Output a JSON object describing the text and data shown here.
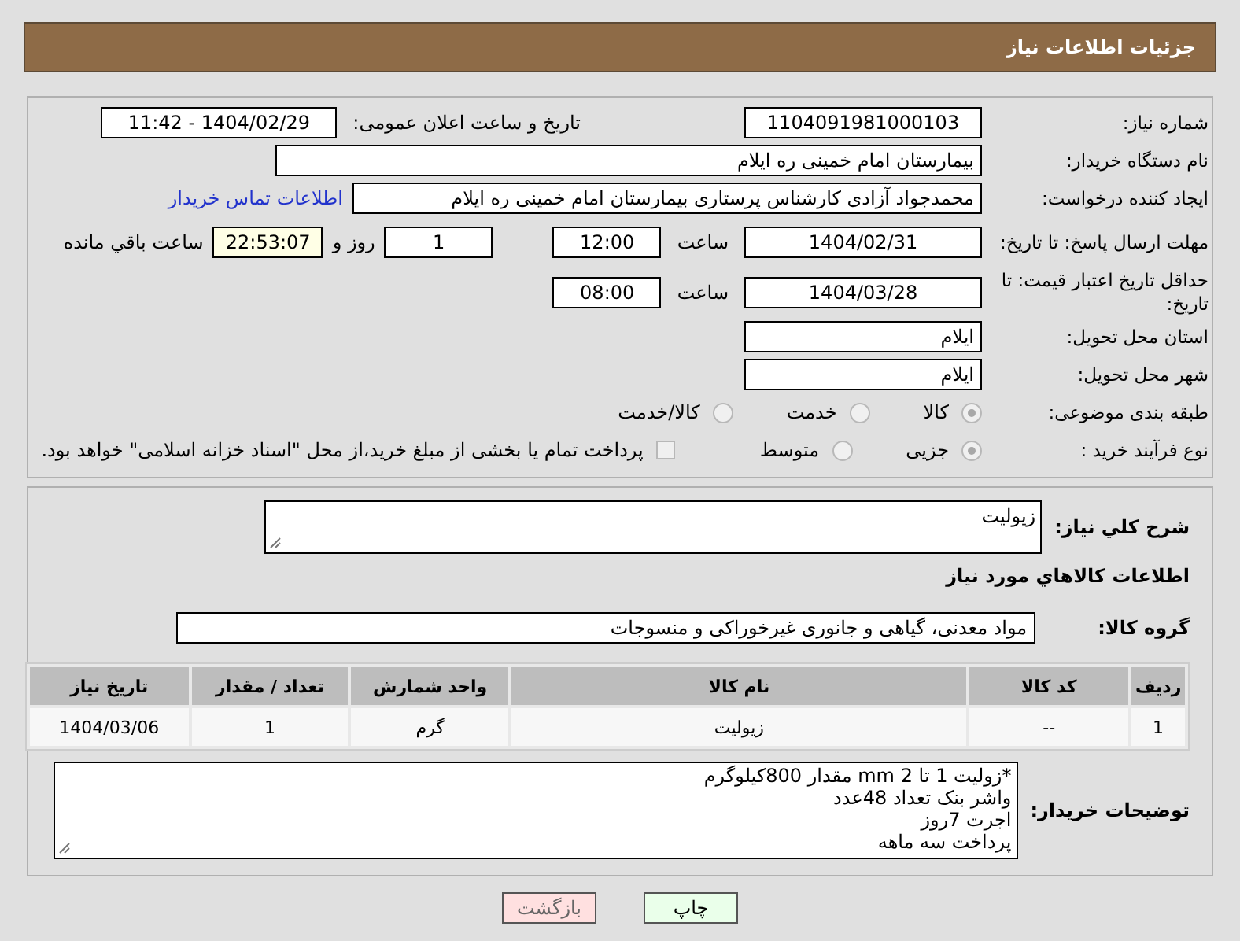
{
  "header": {
    "title": "جزئیات اطلاعات نیاز"
  },
  "need_info": {
    "need_number": {
      "label": "شماره نیاز:",
      "value": "1104091981000103"
    },
    "announce": {
      "label": "تاریخ و ساعت اعلان عمومی:",
      "value": "1404/02/29 - 11:42"
    },
    "buyer": {
      "label": "نام دستگاه خریدار:",
      "value": "بیمارستان امام خمینی  ره  ایلام"
    },
    "requester": {
      "label": "ایجاد کننده درخواست:",
      "value": "محمدجواد آزادی کارشناس پرستاری بیمارستان امام خمینی  ره  ایلام",
      "link": "اطلاعات تماس خریدار"
    },
    "reply_deadline": {
      "label": "مهلت ارسال پاسخ: تا تاریخ:",
      "date": "1404/02/31",
      "time_label": "ساعت",
      "time": "12:00",
      "days": "1",
      "days_label": "روز و",
      "remaining": "22:53:07",
      "remaining_label": "ساعت باقي مانده"
    },
    "price_validity": {
      "label": "حداقل تاریخ اعتبار قیمت: تا تاریخ:",
      "date": "1404/03/28",
      "time_label": "ساعت",
      "time": "08:00"
    },
    "province": {
      "label": "استان محل تحویل:",
      "value": "ایلام"
    },
    "city": {
      "label": "شهر محل تحویل:",
      "value": "ایلام"
    },
    "category": {
      "label": "طبقه بندی موضوعی:",
      "options": [
        {
          "label": "کالا",
          "selected": true
        },
        {
          "label": "خدمت",
          "selected": false
        },
        {
          "label": "کالا/خدمت",
          "selected": false
        }
      ]
    },
    "process": {
      "label": "نوع فرآیند خرید :",
      "options": [
        {
          "label": "جزیی",
          "selected": true
        },
        {
          "label": "متوسط",
          "selected": false
        }
      ],
      "treasury": {
        "checked": false,
        "text": "پرداخت تمام یا بخشی از مبلغ خرید،از محل \"اسناد خزانه اسلامی\" خواهد بود."
      }
    }
  },
  "goods": {
    "description": {
      "label": "شرح کلي نياز:",
      "value": "زیولیت"
    },
    "heading": "اطلاعات كالاهاي مورد نياز",
    "group": {
      "label": "گروه کالا:",
      "value": "مواد معدنی، گیاهی و جانوری غیرخوراکی و منسوجات"
    },
    "table": {
      "columns": [
        "ردیف",
        "کد کالا",
        "نام کالا",
        "واحد شمارش",
        "تعداد / مقدار",
        "تاریخ نیاز"
      ],
      "rows": [
        [
          "1",
          "--",
          "زیولیت",
          "گرم",
          "1",
          "1404/03/06"
        ]
      ]
    },
    "buyer_notes": {
      "label": "توضیحات خریدار:",
      "lines": [
        "*زولیت 1 تا 2 mm مقدار 800کیلوگرم",
        "واشر بنک تعداد 48عدد",
        "اجرت 7روز",
        "پرداخت سه ماهه"
      ]
    }
  },
  "buttons": [
    {
      "label": "چاپ",
      "kind": "print"
    },
    {
      "label": "بازگشت",
      "kind": "back"
    }
  ]
}
